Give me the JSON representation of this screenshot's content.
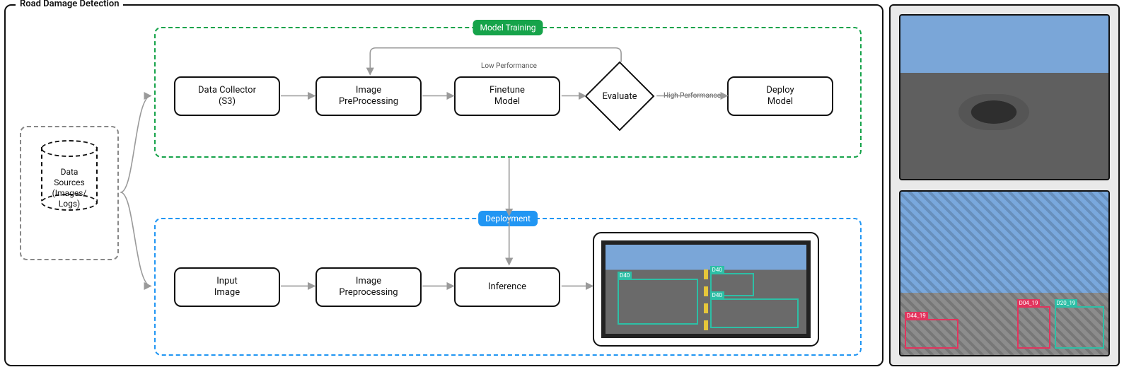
{
  "title": "Road Damage Detection",
  "groups": {
    "training_label": "Model Training",
    "deployment_label": "Deployment"
  },
  "data_sources": {
    "line1": "Data",
    "line2": "Sources",
    "line3": "(Images/",
    "line4": "Logs)"
  },
  "nodes": {
    "data_collector": {
      "line1": "Data Collector",
      "line2": "(S3)"
    },
    "preproc_train": {
      "line1": "Image",
      "line2": "PreProcessing"
    },
    "finetune": {
      "line1": "Finetune",
      "line2": "Model"
    },
    "evaluate": "Evaluate",
    "deploy_model": {
      "line1": "Deploy",
      "line2": "Model"
    },
    "input_image": {
      "line1": "Input",
      "line2": "Image"
    },
    "preproc_deploy": {
      "line1": "Image",
      "line2": "Preprocessing"
    },
    "inference": "Inference"
  },
  "edges": {
    "low_perf": "Low Performance",
    "high_perf": "High Performance"
  },
  "side_images": {
    "top_alt": "Photo of road surface with a pothole and cracked asphalt",
    "bottom_alt": "Dashcam-style road image with detection boxes overlaid",
    "bottom_boxes": [
      {
        "label": "D44_19",
        "color": "red"
      },
      {
        "label": "D04_19",
        "color": "red"
      },
      {
        "label": "D20_19",
        "color": "teal"
      }
    ]
  },
  "output_image_alt": "Road image with multiple detected damage bounding boxes"
}
